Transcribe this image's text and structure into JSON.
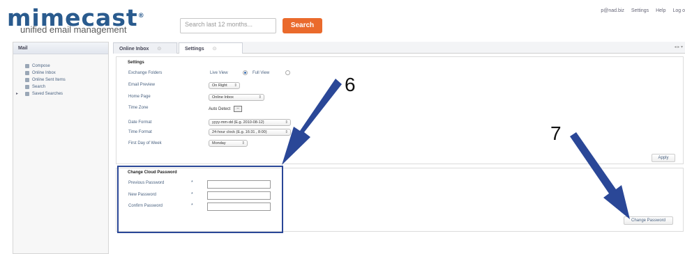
{
  "header": {
    "logo_word": "mimecast",
    "logo_reg": "®",
    "logo_tagline": "unified email management",
    "search_placeholder": "Search last 12 months...",
    "search_button": "Search",
    "top_links": [
      "p@nad.biz",
      "Settings",
      "Help",
      "Log o"
    ]
  },
  "sidebar": {
    "title": "Mail",
    "items": [
      {
        "label": "Compose",
        "icon": "folder-icon"
      },
      {
        "label": "Online Inbox",
        "icon": "folder-icon"
      },
      {
        "label": "Online Sent Items",
        "icon": "folder-icon"
      },
      {
        "label": "Search",
        "icon": "folder-icon"
      },
      {
        "label": "Saved Searches",
        "icon": "folder-icon",
        "expandable": true
      }
    ]
  },
  "tabs": [
    {
      "label": "Online Inbox",
      "close": "⊙"
    },
    {
      "label": "Settings",
      "close": "⊙",
      "active": true
    }
  ],
  "tab_nav": "◂ ▸ ▾",
  "settings": {
    "title": "Settings",
    "exchange_folders": {
      "label": "Exchange Folders",
      "option_live": "Live View",
      "option_full": "Full View",
      "selected": "Live View"
    },
    "email_preview": {
      "label": "Email Preview",
      "value": "On Right"
    },
    "home_page": {
      "label": "Home Page",
      "value": "Online Inbox"
    },
    "time_zone": {
      "label": "Time Zone",
      "value": "Auto Detect",
      "button": "--"
    },
    "date_format": {
      "label": "Date Format",
      "value": "yyyy-mm-dd (E.g. 2010-08-12)"
    },
    "time_format": {
      "label": "Time Format",
      "value": "24-hour clock (E.g. 16:31 , 8:00)"
    },
    "first_day": {
      "label": "First Day of Week",
      "value": "Monday"
    },
    "apply_button": "Apply"
  },
  "password": {
    "title": "Change Cloud Password",
    "previous": "Previous Password",
    "new": "New Password",
    "confirm": "Confirm Password",
    "required_mark": "*",
    "button": "Change Password"
  },
  "annotations": {
    "step6": "6",
    "step7": "7",
    "arrow_color": "#2a4797"
  },
  "colors": {
    "brand": "#2a5b8e",
    "search_button": "#ea6a2c",
    "link": "#4a6280"
  }
}
